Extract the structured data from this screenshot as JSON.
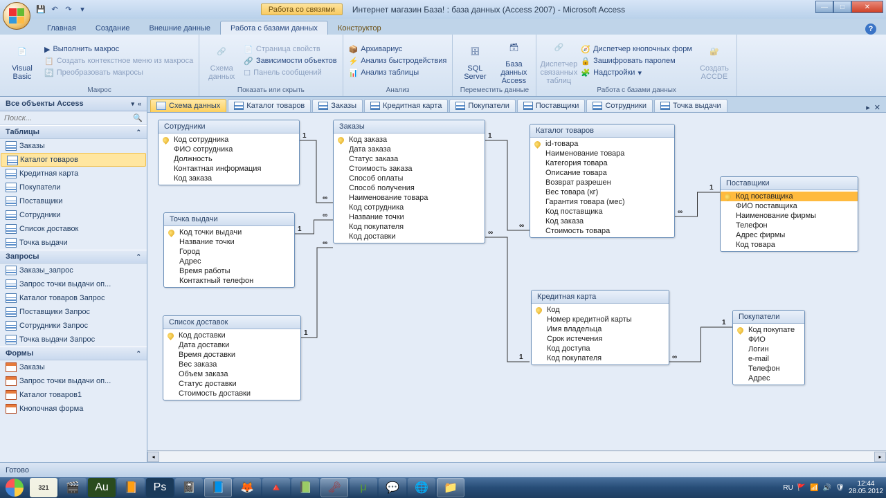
{
  "title": {
    "context_tab": "Работа со связями",
    "document": "Интернет магазин База! : база данных (Access 2007) - Microsoft Access"
  },
  "ribbon_tabs": [
    "Главная",
    "Создание",
    "Внешние данные",
    "Работа с базами данных",
    "Конструктор"
  ],
  "active_ribbon_tab": 3,
  "ribbon": {
    "group_macro": "Макрос",
    "visual_basic": "Visual\nBasic",
    "run_macro": "Выполнить макрос",
    "context_menu": "Создать контекстное меню из макроса",
    "convert_macros": "Преобразовать макросы",
    "group_show": "Показать или скрыть",
    "schema": "Схема\nданных",
    "prop_page": "Страница свойств",
    "dependencies": "Зависимости объектов",
    "msg_panel": "Панель сообщений",
    "group_analyze": "Анализ",
    "archiver": "Архивариус",
    "perf": "Анализ быстродействия",
    "analyze_table": "Анализ таблицы",
    "group_move": "Переместить данные",
    "sql_server": "SQL\nServer",
    "access_db": "База данных\nAccess",
    "linked_mgr": "Диспетчер\nсвязанных таблиц",
    "group_dbtools": "Работа с базами данных",
    "switchboard": "Диспетчер кнопочных форм",
    "encrypt": "Зашифровать паролем",
    "addins": "Надстройки",
    "make_accde": "Создать\nACCDE"
  },
  "nav": {
    "header": "Все объекты Access",
    "search_placeholder": "Поиск...",
    "cat_tables": "Таблицы",
    "tables": [
      "Заказы",
      "Каталог товаров",
      "Кредитная карта",
      "Покупатели",
      "Поставщики",
      "Сотрудники",
      "Список доставок",
      "Точка выдачи"
    ],
    "selected_table": 1,
    "cat_queries": "Запросы",
    "queries": [
      "Заказы_запрос",
      "Запрос точки выдачи оп...",
      "Каталог товаров Запрос",
      "Поставщики Запрос",
      "Сотрудники Запрос",
      "Точка выдачи Запрос"
    ],
    "cat_forms": "Формы",
    "forms": [
      "Заказы",
      "Запрос точки выдачи оп...",
      "Каталог товаров1",
      "Кнопочная форма"
    ]
  },
  "doc_tabs": [
    "Схема данных",
    "Каталог товаров",
    "Заказы",
    "Кредитная карта",
    "Покупатели",
    "Поставщики",
    "Сотрудники",
    "Точка выдачи"
  ],
  "entities": {
    "sotrudniki": {
      "title": "Сотрудники",
      "fields": [
        "Код сотрудника",
        "ФИО сотрудника",
        "Должность",
        "Контактная информация",
        "Код заказа"
      ],
      "pk": [
        0
      ]
    },
    "tochka": {
      "title": "Точка выдачи",
      "fields": [
        "Код точки выдачи",
        "Название точки",
        "Город",
        "Адрес",
        "Время работы",
        "Контактный телефон"
      ],
      "pk": [
        0
      ]
    },
    "dostavok": {
      "title": "Список доставок",
      "fields": [
        "Код доставки",
        "Дата доставки",
        "Время доставки",
        "Вес заказа",
        "Объем заказа",
        "Статус доставки",
        "Стоимость доставки"
      ],
      "pk": [
        0
      ]
    },
    "zakazy": {
      "title": "Заказы",
      "fields": [
        "Код заказа",
        "Дата заказа",
        "Статус заказа",
        "Стоимость заказа",
        "Способ оплаты",
        "Способ получения",
        "Наименование товара",
        "Код сотрудника",
        "Название точки",
        "Код покупателя",
        "Код доставки"
      ],
      "pk": [
        0
      ]
    },
    "katalog": {
      "title": "Каталог товаров",
      "fields": [
        "id-товара",
        "Наименование товара",
        "Категория товара",
        "Описание товара",
        "Возврат разрешен",
        "Вес товара (кг)",
        "Гарантия товара (мес)",
        "Код поставщика",
        "Код заказа",
        "Стоимость товара"
      ],
      "pk": [
        0
      ]
    },
    "postavshiki": {
      "title": "Поставщики",
      "fields": [
        "Код поставщика",
        "ФИО поставщика",
        "Наименование фирмы",
        "Телефон",
        "Адрес фирмы",
        "Код товара"
      ],
      "pk": [
        0
      ],
      "sel": 0
    },
    "karta": {
      "title": "Кредитная карта",
      "fields": [
        "Код",
        "Номер кредитной карты",
        "Имя владельца",
        "Срок истечения",
        "Код доступа",
        "Код покупателя"
      ],
      "pk": [
        0
      ]
    },
    "pokupateli": {
      "title": "Покупатели",
      "fields": [
        "Код покупате",
        "ФИО",
        "Логин",
        "e-mail",
        "Телефон",
        "Адрес"
      ],
      "pk": [
        0
      ]
    }
  },
  "status": "Готово",
  "tray": {
    "lang": "RU",
    "time": "12:44",
    "date": "28.05.2012"
  }
}
